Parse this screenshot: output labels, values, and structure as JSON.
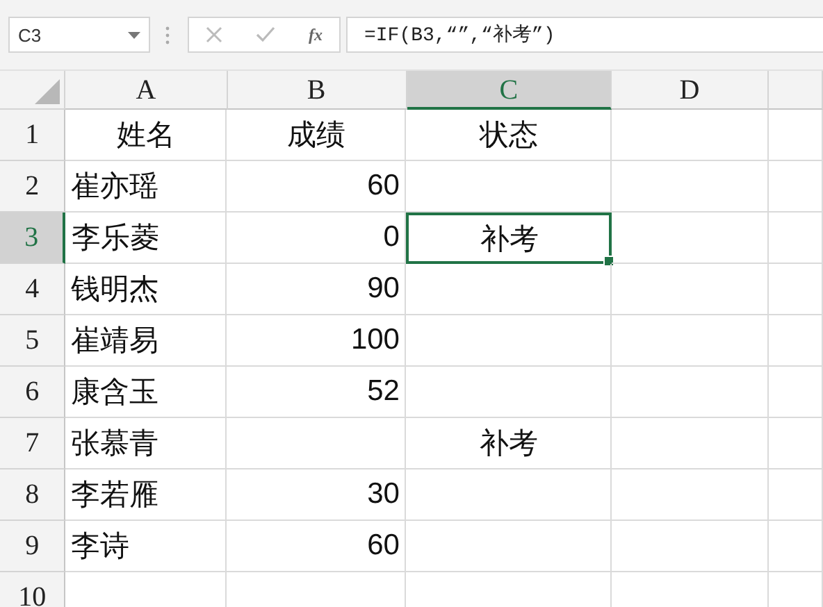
{
  "name_box": {
    "value": "C3"
  },
  "formula_bar": {
    "fx_label": "fx",
    "formula": "=IF(B3,“”,“补考”)",
    "cancel_disabled": true,
    "enter_disabled": true
  },
  "columns": [
    {
      "label": "A",
      "selected": false
    },
    {
      "label": "B",
      "selected": false
    },
    {
      "label": "C",
      "selected": true
    },
    {
      "label": "D",
      "selected": false
    }
  ],
  "rows": [
    {
      "number": "1",
      "selected": false,
      "cells": [
        {
          "kind": "centered",
          "text": "姓名",
          "selected": false
        },
        {
          "kind": "centered",
          "text": "成绩",
          "selected": false
        },
        {
          "kind": "centered",
          "text": "状态",
          "selected": false
        }
      ]
    },
    {
      "number": "2",
      "selected": false,
      "cells": [
        {
          "kind": "text",
          "text": "崔亦瑶",
          "selected": false
        },
        {
          "kind": "number",
          "text": "60",
          "selected": false
        },
        {
          "kind": "empty",
          "selected": false
        }
      ]
    },
    {
      "number": "3",
      "selected": true,
      "cells": [
        {
          "kind": "text",
          "text": "李乐菱",
          "selected": false
        },
        {
          "kind": "number",
          "text": "0",
          "selected": false
        },
        {
          "kind": "centered",
          "text": "补考",
          "selected": true
        }
      ]
    },
    {
      "number": "4",
      "selected": false,
      "cells": [
        {
          "kind": "text",
          "text": "钱明杰",
          "selected": false
        },
        {
          "kind": "number",
          "text": "90",
          "selected": false
        },
        {
          "kind": "empty",
          "selected": false
        }
      ]
    },
    {
      "number": "5",
      "selected": false,
      "cells": [
        {
          "kind": "text",
          "text": "崔靖易",
          "selected": false
        },
        {
          "kind": "number",
          "text": "100",
          "selected": false
        },
        {
          "kind": "empty",
          "selected": false
        }
      ]
    },
    {
      "number": "6",
      "selected": false,
      "cells": [
        {
          "kind": "text",
          "text": "康含玉",
          "selected": false
        },
        {
          "kind": "number",
          "text": "52",
          "selected": false
        },
        {
          "kind": "empty",
          "selected": false
        }
      ]
    },
    {
      "number": "7",
      "selected": false,
      "cells": [
        {
          "kind": "text",
          "text": "张慕青",
          "selected": false
        },
        {
          "kind": "empty",
          "selected": false
        },
        {
          "kind": "centered",
          "text": "补考",
          "selected": false
        }
      ]
    },
    {
      "number": "8",
      "selected": false,
      "cells": [
        {
          "kind": "text",
          "text": "李若雁",
          "selected": false
        },
        {
          "kind": "number",
          "text": "30",
          "selected": false
        },
        {
          "kind": "empty",
          "selected": false
        }
      ]
    },
    {
      "number": "9",
      "selected": false,
      "cells": [
        {
          "kind": "text",
          "text": "李诗",
          "selected": false
        },
        {
          "kind": "number",
          "text": "60",
          "selected": false
        },
        {
          "kind": "empty",
          "selected": false
        }
      ]
    },
    {
      "number": "10",
      "selected": false,
      "cells": [
        {
          "kind": "empty",
          "selected": false
        },
        {
          "kind": "empty",
          "selected": false
        },
        {
          "kind": "empty",
          "selected": false
        }
      ]
    }
  ]
}
